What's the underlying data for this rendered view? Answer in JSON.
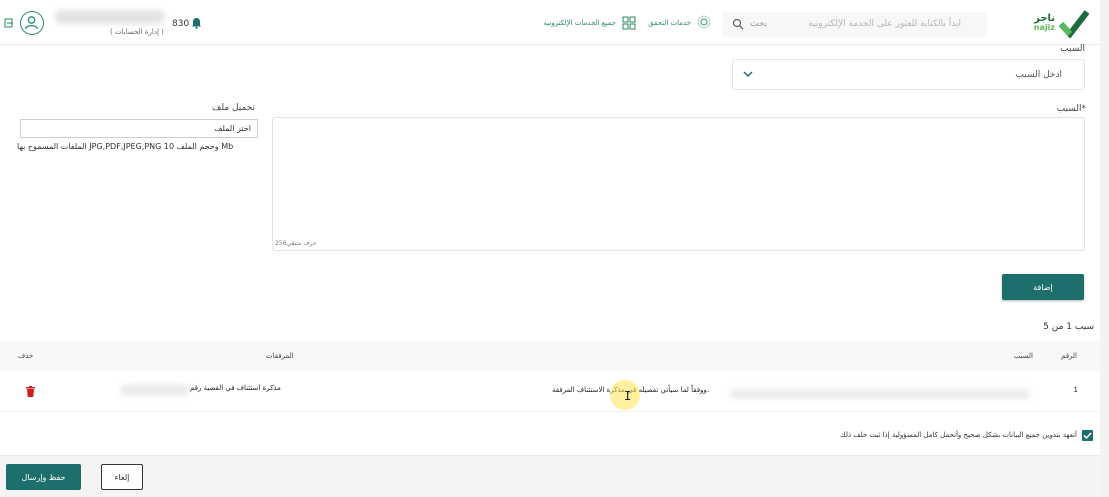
{
  "header": {
    "logo_text_ar": "ناجز",
    "logo_text_en": "najiz",
    "search_placeholder": "ابدأ بالكتابة للعثور على الخدمة الإلكترونية",
    "search_button": "بحث",
    "nav_verify": "خدمات التحقق",
    "nav_services": "جميع الخدمات الإلكترونية",
    "notification_count": "830",
    "manage_accounts": "( إدارة الحسابات )"
  },
  "form": {
    "reason_type_label": "السبب",
    "reason_select_value": "ادخل السبب",
    "reason_label": "السبب*",
    "char_counter": "256حرف متبقي",
    "upload_label": "تحميل ملف",
    "file_input_text": "اختر الملف",
    "file_hint": "الملفات المسموح بها JPG,PDF,JPEG,PNG وحجم الملف 10 Mb",
    "add_button": "إضافة"
  },
  "table": {
    "count_label": "سبب 1 من 5",
    "headers": {
      "number": "الرقم",
      "reason": "السبب",
      "attachments": "المرفقات",
      "delete": "حذف"
    },
    "rows": [
      {
        "number": "1",
        "reason": "ووفقاً لما سيأتي تفصيله في مذكرة الاستئناف المرفقة.",
        "attachment": "مذكرة استئناف في القضية رقم"
      }
    ]
  },
  "pledge": {
    "text": "أتعهد بتدوين جميع البيانات بشكل صحيح وأتحمل كامل المسؤولية إذا ثبت خلف ذلك",
    "checked": true
  },
  "footer": {
    "save_send": "حفظ وإرسال",
    "cancel": "إلغاء"
  },
  "colors": {
    "primary": "#1c6f6a",
    "accent_green": "#2a8a5a",
    "delete_red": "#d11f1f"
  }
}
